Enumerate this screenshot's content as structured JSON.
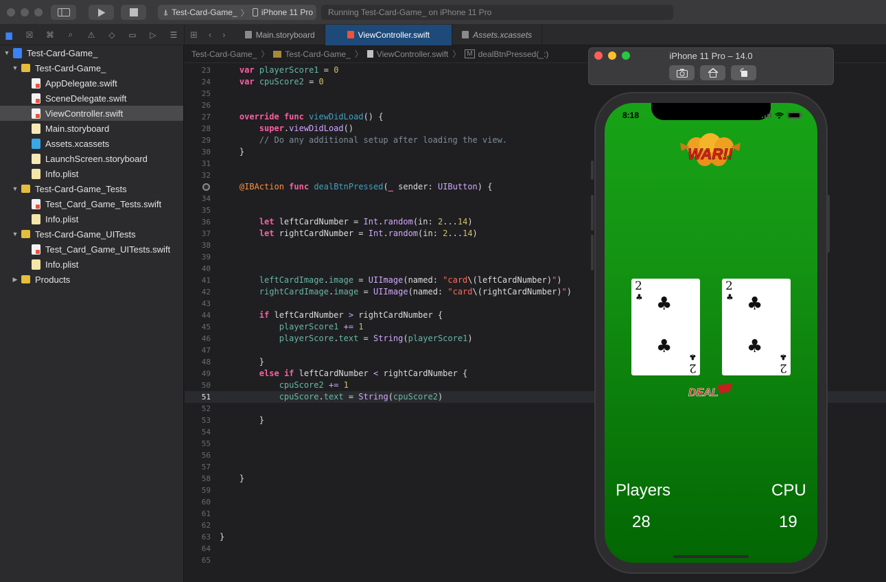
{
  "toolbar": {
    "scheme_project": "Test-Card-Game_",
    "scheme_device": "iPhone 11 Pro",
    "activity": "Running Test-Card-Game_ on iPhone 11 Pro"
  },
  "navigator": {
    "items": [
      {
        "label": "Test-Card-Game_",
        "icon": "xcode-project-icon",
        "disclosure": "▼"
      },
      {
        "label": "Test-Card-Game_",
        "icon": "folder-icon",
        "disclosure": "▼"
      },
      {
        "label": "AppDelegate.swift",
        "icon": "swift-file-icon",
        "disclosure": ""
      },
      {
        "label": "SceneDelegate.swift",
        "icon": "swift-file-icon",
        "disclosure": ""
      },
      {
        "label": "ViewController.swift",
        "icon": "swift-file-icon",
        "disclosure": ""
      },
      {
        "label": "Main.storyboard",
        "icon": "storyboard-file-icon",
        "disclosure": ""
      },
      {
        "label": "Assets.xcassets",
        "icon": "asset-catalog-icon",
        "disclosure": ""
      },
      {
        "label": "LaunchScreen.storyboard",
        "icon": "storyboard-file-icon",
        "disclosure": ""
      },
      {
        "label": "Info.plist",
        "icon": "plist-file-icon",
        "disclosure": ""
      },
      {
        "label": "Test-Card-Game_Tests",
        "icon": "folder-icon",
        "disclosure": "▼"
      },
      {
        "label": "Test_Card_Game_Tests.swift",
        "icon": "swift-file-icon",
        "disclosure": ""
      },
      {
        "label": "Info.plist",
        "icon": "plist-file-icon",
        "disclosure": ""
      },
      {
        "label": "Test-Card-Game_UITests",
        "icon": "folder-icon",
        "disclosure": "▼"
      },
      {
        "label": "Test_Card_Game_UITests.swift",
        "icon": "swift-file-icon",
        "disclosure": ""
      },
      {
        "label": "Info.plist",
        "icon": "plist-file-icon",
        "disclosure": ""
      },
      {
        "label": "Products",
        "icon": "folder-icon",
        "disclosure": "▶"
      }
    ],
    "selected": "ViewController.swift"
  },
  "tabs": [
    "Main.storyboard",
    "ViewController.swift",
    "Assets.xcassets"
  ],
  "active_tab": "ViewController.swift",
  "jumpbar": [
    "Test-Card-Game_",
    "Test-Card-Game_",
    "ViewController.swift",
    "M",
    "dealBtnPressed(_:)"
  ],
  "current_line": 51,
  "simulator": {
    "title": "iPhone 11 Pro – 14.0",
    "status_time": "8:18",
    "logo_text": "WAR!!",
    "deal_text": "DEAL",
    "left_card": {
      "rank": "2",
      "suit": "♣"
    },
    "right_card": {
      "rank": "2",
      "suit": "♣"
    },
    "players_label": "Players",
    "cpu_label": "CPU",
    "players_score": "28",
    "cpu_score": "19"
  },
  "colors": {
    "accent": "#1e4a7a",
    "keyword": "#fc5fa3",
    "type": "#d0a8ff",
    "property": "#67b7a4",
    "number": "#d0bf69",
    "string": "#fc6a5d",
    "comment": "#7f8c98",
    "function": "#41a1c0",
    "attribute": "#fd8f3f",
    "felt_green": "#149313"
  }
}
